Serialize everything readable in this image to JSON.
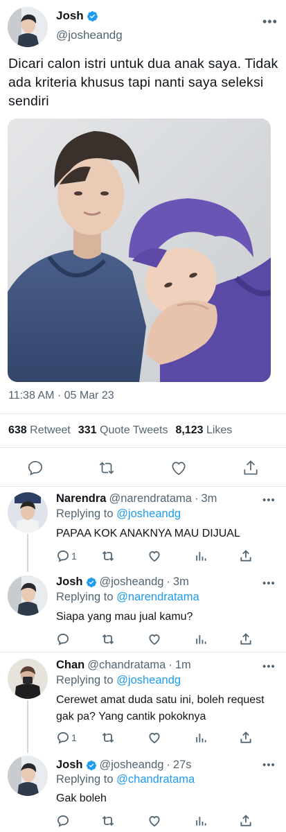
{
  "main_tweet": {
    "author_name": "Josh",
    "author_handle": "@josheandg",
    "verified": true,
    "text": "Dicari calon istri untuk dua anak saya. Tidak ada kriteria khusus tapi nanti saya seleksi sendiri",
    "timestamp": "11:38 AM · 05 Mar 23",
    "stats": {
      "retweets_count": "638",
      "retweets_label": "Retweet",
      "quotes_count": "331",
      "quotes_label": "Quote Tweets",
      "likes_count": "8,123",
      "likes_label": "Likes"
    },
    "actions": [
      "reply-icon",
      "retweet-icon",
      "like-icon",
      "share-icon"
    ]
  },
  "replies": [
    {
      "name": "Narendra",
      "handle": "@narendratama",
      "time": "3m",
      "verified": false,
      "replying_to_label": "Replying to",
      "replying_to": "@josheandg",
      "text": "PAPAA KOK ANAKNYA MAU DIJUAL",
      "reply_count": "1"
    },
    {
      "name": "Josh",
      "handle": "@josheandg",
      "time": "3m",
      "verified": true,
      "replying_to_label": "Replying to",
      "replying_to": "@narendratama",
      "text": "Siapa yang mau jual kamu?",
      "reply_count": ""
    },
    {
      "name": "Chan",
      "handle": "@chandratama",
      "time": "1m",
      "verified": false,
      "replying_to_label": "Replying to",
      "replying_to": "@josheandg",
      "text": "Cerewet amat duda satu ini, boleh request gak pa? Yang cantik pokoknya",
      "reply_count": "1"
    },
    {
      "name": "Josh",
      "handle": "@josheandg",
      "time": "27s",
      "verified": true,
      "replying_to_label": "Replying to",
      "replying_to": "@chandratama",
      "text": "Gak boleh",
      "reply_count": ""
    }
  ],
  "colors": {
    "accent": "#1d9bf0",
    "text_primary": "#0f1419",
    "text_secondary": "#536471",
    "divider": "#e6e9ec"
  },
  "icons": {
    "more": "more-icon",
    "verified": "verified-badge-icon",
    "reply": "reply-icon",
    "retweet": "retweet-icon",
    "like": "like-icon",
    "views": "views-icon",
    "share": "share-icon"
  }
}
